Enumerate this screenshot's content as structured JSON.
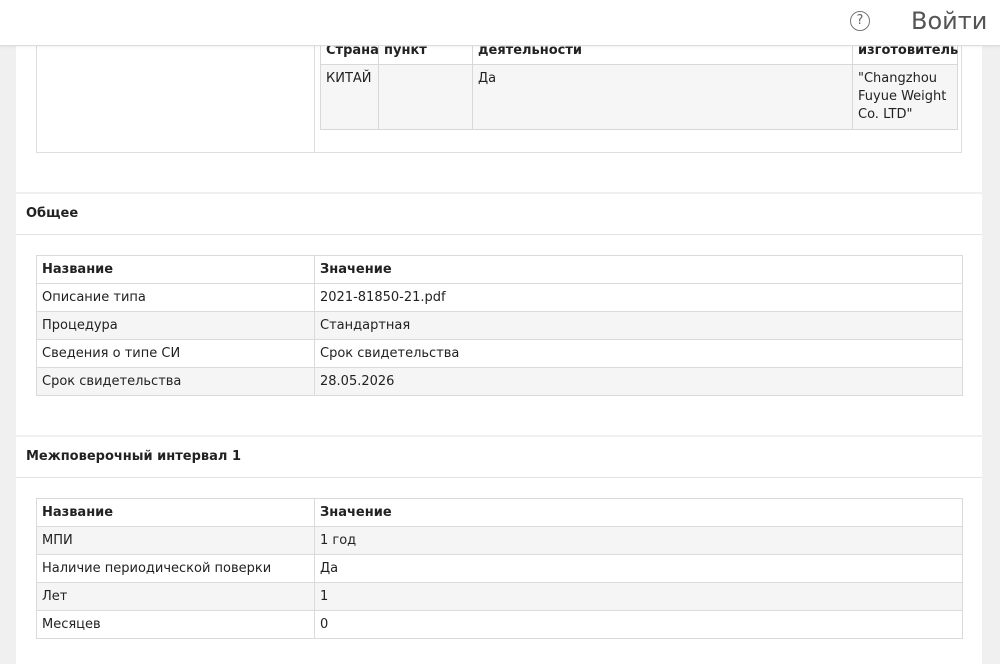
{
  "header": {
    "help_icon": "?",
    "login_label": "Войти"
  },
  "manufacturer": {
    "columns": [
      "Страна",
      "пункт",
      "деятельности",
      "изготовитель"
    ],
    "rows": [
      [
        "КИТАЙ",
        "",
        "Да",
        "\"Changzhou Fuyue Weight Co. LTD\""
      ]
    ]
  },
  "general": {
    "title": "Общее",
    "header": [
      "Название",
      "Значение"
    ],
    "rows": [
      [
        "Описание типа",
        "2021-81850-21.pdf"
      ],
      [
        "Процедура",
        "Стандартная"
      ],
      [
        "Сведения о типе СИ",
        "Срок свидетельства"
      ],
      [
        "Срок свидетельства",
        "28.05.2026"
      ]
    ]
  },
  "mpi": {
    "title": "Межповерочный интервал 1",
    "header": [
      "Название",
      "Значение"
    ],
    "rows": [
      [
        "МПИ",
        "1 год"
      ],
      [
        "Наличие периодической поверки",
        "Да"
      ],
      [
        "Лет",
        "1"
      ],
      [
        "Месяцев",
        "0"
      ]
    ]
  }
}
